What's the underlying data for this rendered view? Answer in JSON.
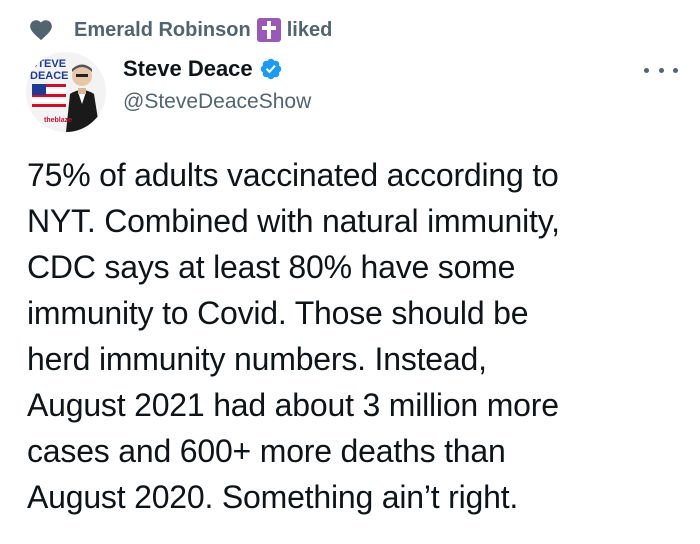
{
  "social_context": {
    "liker_name": "Emerald Robinson",
    "action": "liked",
    "icon": "heart-icon",
    "emoji": "latin-cross-emoji"
  },
  "tweet": {
    "author": {
      "display_name": "Steve Deace",
      "handle": "@SteveDeaceShow",
      "verified": true,
      "avatar_text_top": "STEVE",
      "avatar_text_bottom": "DEACE",
      "avatar_badge": "theblaze"
    },
    "text": "75% of adults vaccinated according to\nNYT. Combined with natural immunity,\nCDC says at least 80% have some\nimmunity to Covid. Those should be\nherd immunity numbers. Instead,\nAugust 2021 had about 3 million more\ncases and 600+ more deaths than\nAugust 2020. Something ain’t right."
  },
  "colors": {
    "text_primary": "#0f1419",
    "text_secondary": "#536471",
    "verified_blue": "#1d9bf0"
  }
}
